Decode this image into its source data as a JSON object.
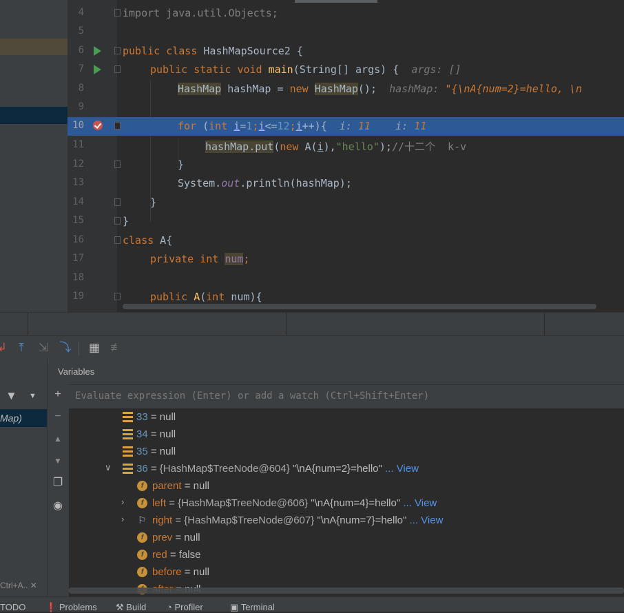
{
  "editor": {
    "lines": [
      {
        "no": "4",
        "current": false
      },
      {
        "no": "5",
        "current": false
      },
      {
        "no": "6",
        "current": false
      },
      {
        "no": "7",
        "current": false
      },
      {
        "no": "8",
        "current": false
      },
      {
        "no": "9",
        "current": false
      },
      {
        "no": "10",
        "current": true
      },
      {
        "no": "11",
        "current": false
      },
      {
        "no": "12",
        "current": false
      },
      {
        "no": "13",
        "current": false
      },
      {
        "no": "14",
        "current": false
      },
      {
        "no": "15",
        "current": false
      },
      {
        "no": "16",
        "current": false
      },
      {
        "no": "17",
        "current": false
      },
      {
        "no": "18",
        "current": false
      },
      {
        "no": "19",
        "current": false
      }
    ],
    "code": {
      "l4_import": "import java.util.Objects;",
      "l6_public": "public",
      "l6_class": "class",
      "l6_name": "HashMapSource2 {",
      "l7_public": "public",
      "l7_static": "static",
      "l7_void": "void",
      "l7_main": "main",
      "l7_params": "(String[] args) {",
      "l7_hint": "args: []",
      "l8_type": "HashMap",
      "l8_var": " hashMap = ",
      "l8_new": "new",
      "l8_ctor": "HashMap",
      "l8_end": "();",
      "l8_hint_label": "hashMap:",
      "l8_hint_val": "\"{\\nA{num=2}=hello, \\n",
      "l10_for": "for",
      "l10_open": " (",
      "l10_int": "int",
      "l10_i1": "i",
      "l10_eq": "=",
      "l10_one": "1",
      "l10_semi1": ";",
      "l10_i2": "i",
      "l10_le": "<=",
      "l10_twelve": "12",
      "l10_semi2": ";",
      "l10_i3": "i",
      "l10_inc": "++){",
      "l10_hint1_label": "i:",
      "l10_hint1_val": "11",
      "l10_hint2_label": "i:",
      "l10_hint2_val": "11",
      "l11_put": "hashMap.put",
      "l11_open": "(",
      "l11_new": "new",
      "l11_a": " A(",
      "l11_i": "i",
      "l11_close": "),",
      "l11_str": "\"hello\"",
      "l11_end": ");",
      "l11_comment": "//十二个  k-v",
      "l12_brace": "}",
      "l13_system": "System.",
      "l13_out": "out",
      "l13_print": ".println(hashMap);",
      "l14_brace": "}",
      "l15_brace": "}",
      "l16_class": "class",
      "l16_name": " A{",
      "l17_private": "private",
      "l17_int": "int",
      "l17_num": "num",
      "l17_semi": ";",
      "l19_public": "public",
      "l19_ctor": "A",
      "l19_open": "(",
      "l19_int": "int",
      "l19_rest": " num){"
    }
  },
  "debug": {
    "variables_title": "Variables",
    "watch_placeholder": "Evaluate expression (Enter) or add a watch (Ctrl+Shift+Enter)",
    "frame_selected": "Map)",
    "frames_bottom_hint": "Ctrl+A..",
    "tree": [
      {
        "indent": 1,
        "icon": "array-entry-icon",
        "name": "33",
        "value": " = null"
      },
      {
        "indent": 1,
        "icon": "array-entry-icon",
        "name": "34",
        "value": " = null"
      },
      {
        "indent": 1,
        "icon": "array-entry-icon",
        "name": "35",
        "value": " = null"
      },
      {
        "indent": 1,
        "icon": "array-entry-icon",
        "expanded": true,
        "name": "36",
        "ref": " = {HashMap$TreeNode@604} ",
        "str": "\"\\nA{num=2}=hello\"",
        "link": " ... View"
      },
      {
        "indent": 2,
        "icon": "field-icon",
        "name": "parent",
        "value": " = null"
      },
      {
        "indent": 2,
        "icon": "field-icon",
        "collapsed": true,
        "name": "left",
        "ref": " = {HashMap$TreeNode@606} ",
        "str": "\"\\nA{num=4}=hello\"",
        "link": " ... View"
      },
      {
        "indent": 2,
        "icon": "flag-icon",
        "collapsed": true,
        "name": "right",
        "ref": " = {HashMap$TreeNode@607} ",
        "str": "\"\\nA{num=7}=hello\"",
        "link": " ... View"
      },
      {
        "indent": 2,
        "icon": "field-icon",
        "name": "prev",
        "value": " = null"
      },
      {
        "indent": 2,
        "icon": "field-icon",
        "name": "red",
        "value": " = false"
      },
      {
        "indent": 2,
        "icon": "field-icon",
        "name": "before",
        "value": " = null"
      },
      {
        "indent": 2,
        "icon": "field-icon",
        "name": "after",
        "value": " = null"
      }
    ]
  },
  "statusbar": {
    "todo": "TODO",
    "problems": "Problems",
    "build": "Build",
    "profiler": "Profiler",
    "terminal": "Terminal"
  }
}
